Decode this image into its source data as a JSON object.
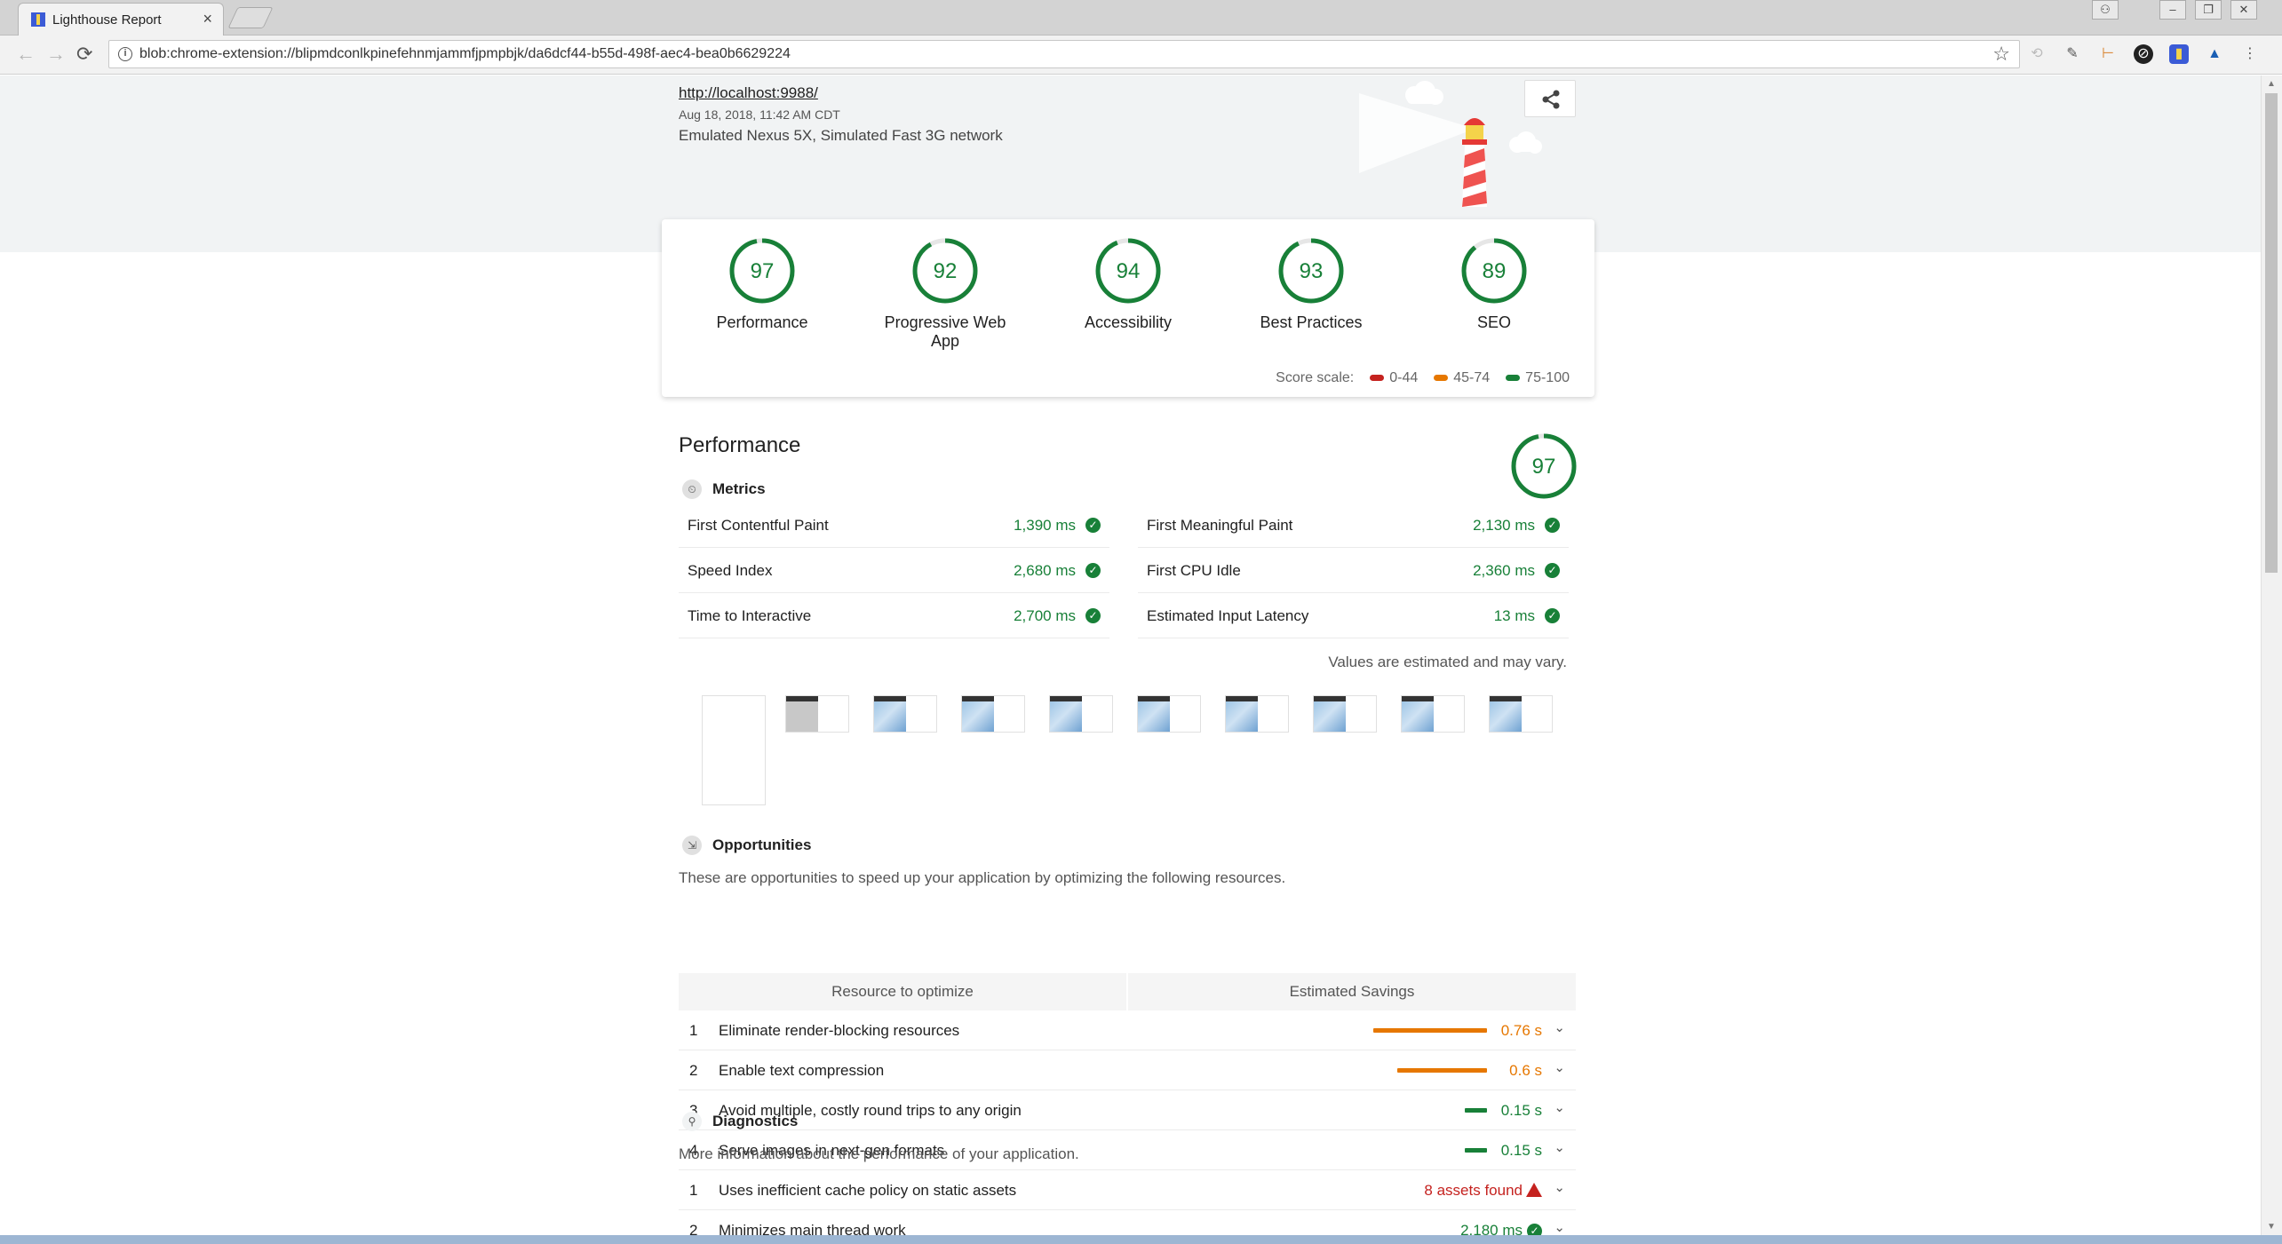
{
  "browser": {
    "tab_title": "Lighthouse Report",
    "tab_close": "×",
    "url": "blob:chrome-extension://blipmdconlkpinefehnmjammfjpmpbjk/da6dcf44-b55d-498f-aec4-bea0b6629224",
    "back_icon": "←",
    "forward_icon": "→",
    "reload_icon": "⟳",
    "info_icon": "i",
    "star_icon": "☆"
  },
  "report": {
    "final_url": "http://localhost:9988/",
    "fetch_time": "Aug 18, 2018, 11:42 AM CDT",
    "device": "Emulated Nexus 5X, Simulated Fast 3G network"
  },
  "scores": [
    {
      "label": "Performance",
      "value": "97",
      "fraction": 0.97
    },
    {
      "label": "Progressive Web App",
      "value": "92",
      "fraction": 0.92
    },
    {
      "label": "Accessibility",
      "value": "94",
      "fraction": 0.94
    },
    {
      "label": "Best Practices",
      "value": "93",
      "fraction": 0.93
    },
    {
      "label": "SEO",
      "value": "89",
      "fraction": 0.89
    }
  ],
  "scale": {
    "label": "Score scale:",
    "fail": "0-44",
    "average": "45-74",
    "pass": "75-100",
    "colors": {
      "fail": "#c5221f",
      "average": "#e67700",
      "pass": "#188038"
    }
  },
  "performance": {
    "title": "Performance",
    "score": "97",
    "score_fraction": 0.97,
    "metrics_title": "Metrics",
    "metrics": [
      {
        "name": "First Contentful Paint",
        "value": "1,390 ms"
      },
      {
        "name": "First Meaningful Paint",
        "value": "2,130 ms"
      },
      {
        "name": "Speed Index",
        "value": "2,680 ms"
      },
      {
        "name": "First CPU Idle",
        "value": "2,360 ms"
      },
      {
        "name": "Time to Interactive",
        "value": "2,700 ms"
      },
      {
        "name": "Estimated Input Latency",
        "value": "13 ms"
      }
    ],
    "vary_note": "Values are estimated and may vary.",
    "opportunities_title": "Opportunities",
    "opportunities_desc": "These are opportunities to speed up your application by optimizing the following resources.",
    "opp_col_resource": "Resource to optimize",
    "opp_col_savings": "Estimated Savings",
    "opportunities": [
      {
        "index": "1",
        "title": "Eliminate render-blocking resources",
        "savings": "0.76 s",
        "seconds": 0.76
      },
      {
        "index": "2",
        "title": "Enable text compression",
        "savings": "0.6 s",
        "seconds": 0.6
      },
      {
        "index": "3",
        "title": "Avoid multiple, costly round trips to any origin",
        "savings": "0.15 s",
        "seconds": 0.15
      },
      {
        "index": "4",
        "title": "Serve images in next-gen formats",
        "savings": "0.15 s",
        "seconds": 0.15
      }
    ],
    "diagnostics_title": "Diagnostics",
    "diagnostics_desc": "More information about the performance of your application.",
    "diagnostics": [
      {
        "index": "1",
        "title": "Uses inefficient cache policy on static assets",
        "value": "8 assets found"
      },
      {
        "index": "2",
        "title": "Minimizes main thread work",
        "value": "2,180 ms"
      }
    ]
  }
}
